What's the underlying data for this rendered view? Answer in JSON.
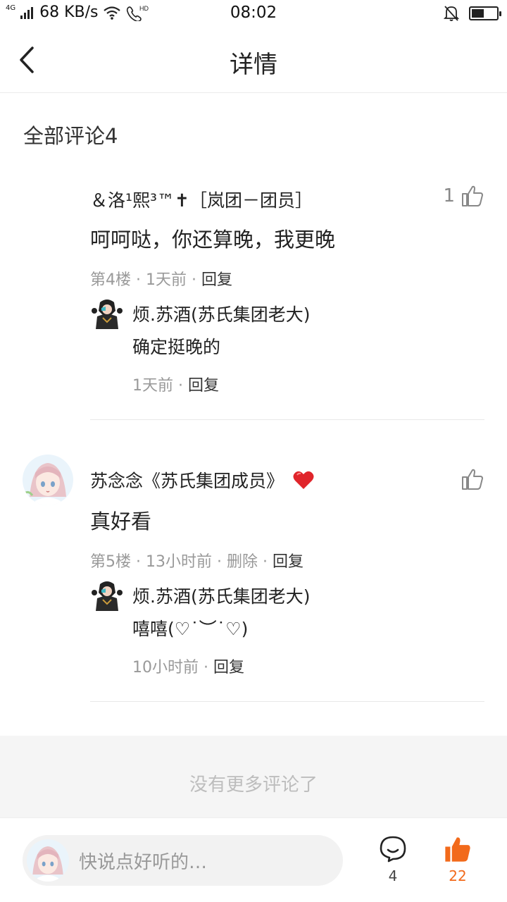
{
  "status_bar": {
    "network_tag": "4G",
    "speed": "68 KB/s",
    "hd_tag": "HD",
    "time": "08:02",
    "battery_level": 0.5
  },
  "header": {
    "title": "详情",
    "back_icon": "chevron-left-icon"
  },
  "section": {
    "title": "全部评论4"
  },
  "comments": [
    {
      "author": "＆洛¹熙³™✝［岚团－团员］",
      "likes": "1",
      "text": "呵呵哒，你还算晚，我更晚",
      "floor": "第4楼",
      "time": "1天前",
      "delete_label": "",
      "reply_label": "回复",
      "reply": {
        "author": "烦.苏酒(苏氏集团老大)",
        "text": "确定挺晚的",
        "time": "1天前",
        "reply_label": "回复"
      }
    },
    {
      "author": "苏念念《苏氏集团成员》",
      "likes": "",
      "text": "真好看",
      "floor": "第5楼",
      "time": "13小时前",
      "delete_label": "删除",
      "reply_label": "回复",
      "reply": {
        "author": "烦.苏酒(苏氏集团老大)",
        "text": "嘻嘻(♡˙︶˙♡)",
        "time": "10小时前",
        "reply_label": "回复"
      }
    }
  ],
  "no_more": "没有更多评论了",
  "bottom_bar": {
    "input_placeholder": "快说点好听的…",
    "comment_count": "4",
    "like_count": "22"
  },
  "colors": {
    "accent": "#f26a1b",
    "heart": "#e0252b",
    "text": "#222222",
    "meta": "#999999"
  }
}
